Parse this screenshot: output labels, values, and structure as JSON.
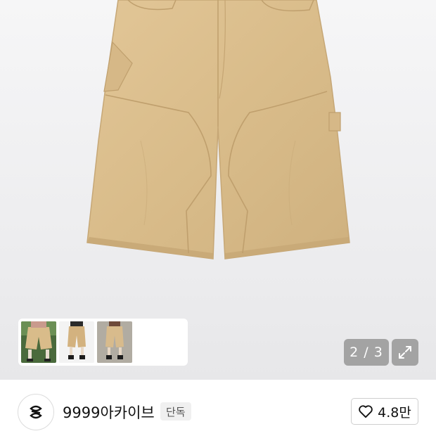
{
  "gallery": {
    "counter": "2 / 3",
    "thumbnails": [
      "thumbnail-1",
      "thumbnail-2",
      "thumbnail-3"
    ]
  },
  "store": {
    "name": "9999아카이브",
    "badge": "단독"
  },
  "like": {
    "count": "4.8만"
  },
  "colors": {
    "product": "#dcbf8e",
    "overlay": "#969696"
  },
  "icons": [
    "expand-icon",
    "heart-icon",
    "store-logo-icon"
  ]
}
